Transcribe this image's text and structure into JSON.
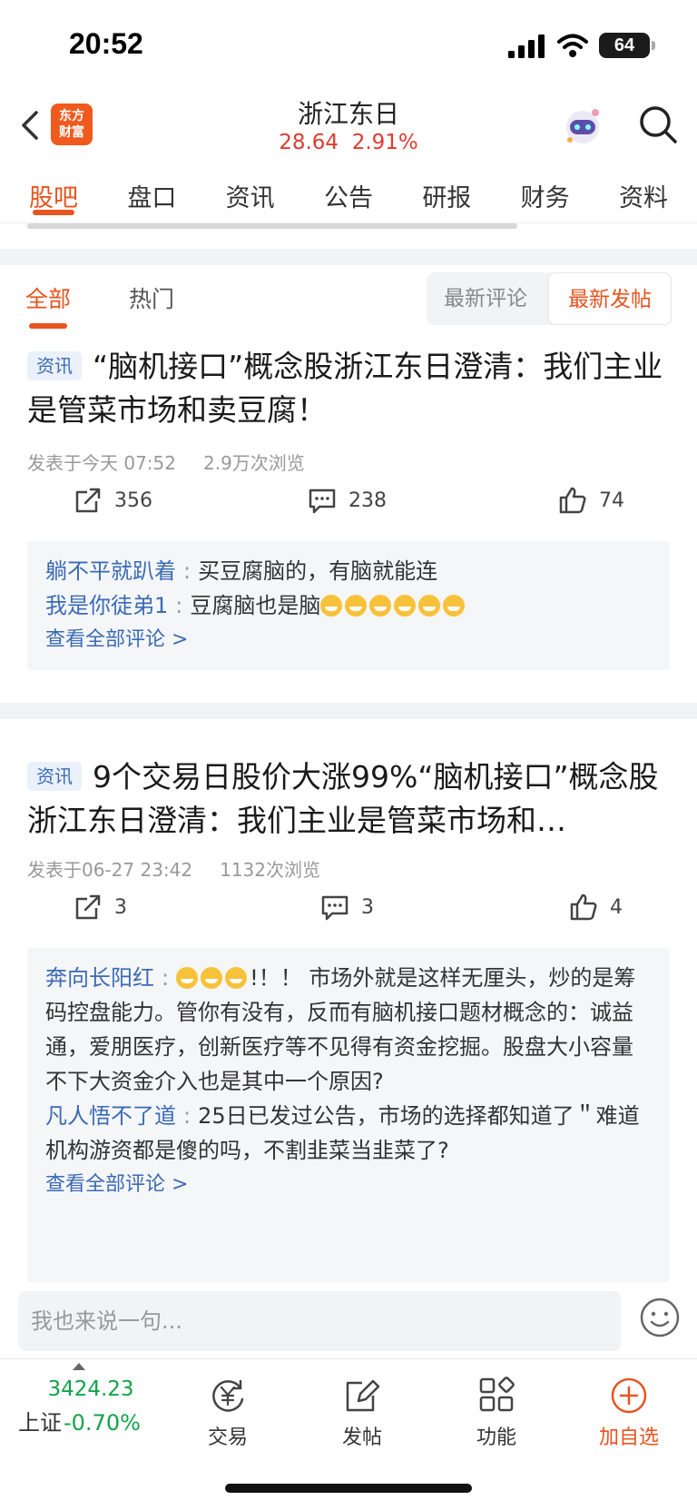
{
  "status": {
    "time": "20:52",
    "battery": "64"
  },
  "header": {
    "logo_line1": "东方",
    "logo_line2": "财富",
    "stock_name": "浙江东日",
    "price": "28.64",
    "change_pct": "2.91%"
  },
  "tabs": [
    "股吧",
    "盘口",
    "资讯",
    "公告",
    "研报",
    "财务",
    "资料"
  ],
  "filter": {
    "tab_all": "全部",
    "tab_hot": "热门",
    "sort_latest_comment": "最新评论",
    "sort_latest_post": "最新发帖"
  },
  "posts": [
    {
      "tag": "资讯",
      "title": "“脑机接口”概念股浙江东日澄清：我们主业是管菜市场和卖豆腐！",
      "posted": "发表于今天 07:52",
      "views": "2.9万次浏览",
      "shares": "356",
      "comments_count": "238",
      "likes": "74",
      "comments": [
        {
          "user": "躺不平就趴着",
          "text": "买豆腐脑的，有脑就能连"
        },
        {
          "user": "我是你徒弟1",
          "text": "豆腐脑也是脑"
        }
      ],
      "view_all": "查看全部评论 >"
    },
    {
      "tag": "资讯",
      "title": "9个交易日股价大涨99%“脑机接口”概念股浙江东日澄清：我们主业是管菜市场和…",
      "posted": "发表于06-27 23:42",
      "views": "1132次浏览",
      "shares": "3",
      "comments_count": "3",
      "likes": "4",
      "comments": [
        {
          "user": "奔向长阳红",
          "text": "!！！ 市场外就是这样无厘头，炒的是筹码控盘能力。管你有没有，反而有脑机接口题材概念的：诚益通，爱朋医疗，创新医疗等不见得有资金挖掘。股盘大小容量不下大资金介入也是其中一个原因?"
        },
        {
          "user": "凡人悟不了道",
          "text": "25日已发过公告，市场的选择都知道了＂难道机构游资都是傻的吗，不割韭菜当韭菜了?"
        }
      ],
      "view_all": "查看全部评论 >"
    }
  ],
  "input": {
    "placeholder": "我也来说一句..."
  },
  "bottom": {
    "index_value": "3424.23",
    "index_name": "上证",
    "index_change": "-0.70%",
    "trade": "交易",
    "post": "发帖",
    "functions": "功能",
    "add_watch": "加自选"
  }
}
